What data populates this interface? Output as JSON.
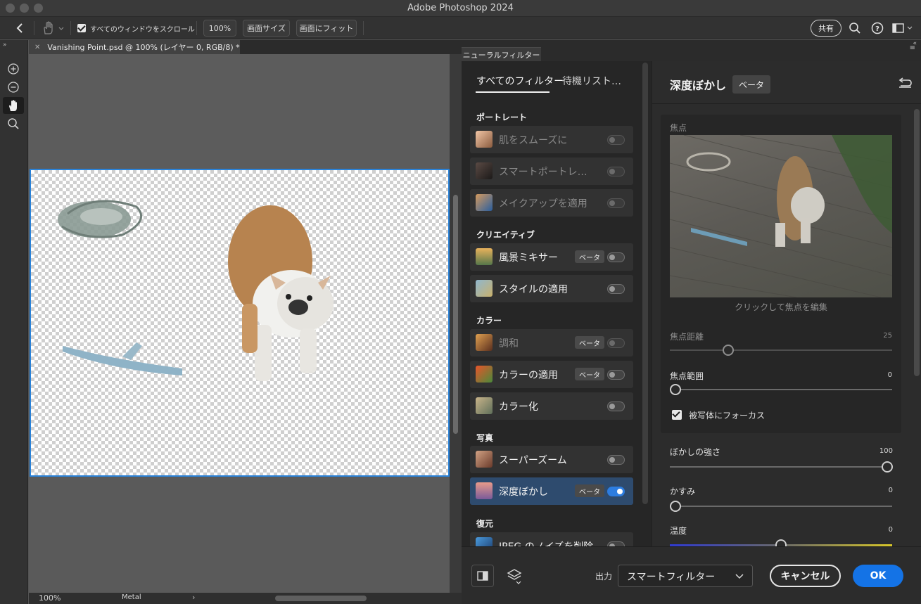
{
  "window": {
    "title": "Adobe Photoshop 2024"
  },
  "options_bar": {
    "scroll_all_label": "すべてのウィンドウをスクロール",
    "zoom_100": "100%",
    "fit_screen": "画面サイズ",
    "fill_screen": "画面にフィット",
    "share": "共有"
  },
  "document": {
    "tab_title": "Vanishing Point.psd @ 100% (レイヤー 0, RGB/8) *",
    "zoom": "100%",
    "status": "Metal"
  },
  "neural_filters": {
    "panel_tab": "ニューラルフィルター",
    "tabs": [
      {
        "label": "すべてのフィルター"
      },
      {
        "label": "待機リスト…"
      }
    ],
    "categories": [
      {
        "label": "ポートレート"
      },
      {
        "label": "クリエイティブ"
      },
      {
        "label": "カラー"
      },
      {
        "label": "写真"
      },
      {
        "label": "復元"
      }
    ],
    "items": [
      {
        "label": "肌をスムーズに",
        "beta": "",
        "on": false,
        "dim": true
      },
      {
        "label": "スマートポートレ…",
        "beta": "",
        "on": false,
        "dim": true
      },
      {
        "label": "メイクアップを適用",
        "beta": "",
        "on": false,
        "dim": true
      },
      {
        "label": "風景ミキサー",
        "beta": "ベータ",
        "on": false,
        "dim": false
      },
      {
        "label": "スタイルの適用",
        "beta": "",
        "on": false,
        "dim": false
      },
      {
        "label": "調和",
        "beta": "ベータ",
        "on": false,
        "dim": true
      },
      {
        "label": "カラーの適用",
        "beta": "ベータ",
        "on": false,
        "dim": false
      },
      {
        "label": "カラー化",
        "beta": "",
        "on": false,
        "dim": false
      },
      {
        "label": "スーパーズーム",
        "beta": "",
        "on": false,
        "dim": false
      },
      {
        "label": "深度ぼかし",
        "beta": "ベータ",
        "on": true,
        "dim": false
      },
      {
        "label": "JPEG のノイズを削除",
        "beta": "",
        "on": false,
        "dim": false
      }
    ],
    "detail": {
      "title": "深度ぼかし",
      "beta": "ベータ",
      "focal_point_label": "焦点",
      "click_hint": "クリックして焦点を編集",
      "focal_distance_label": "焦点距離",
      "focal_distance_value": "25",
      "focal_range_label": "焦点範囲",
      "focal_range_value": "0",
      "focus_subject_label": "被写体にフォーカス",
      "blur_strength_label": "ぼかしの強さ",
      "blur_strength_value": "100",
      "haze_label": "かすみ",
      "haze_value": "0",
      "temperature_label": "温度",
      "temperature_value": "0"
    },
    "footer": {
      "output_label": "出力",
      "output_value": "スマートフィルター",
      "cancel": "キャンセル",
      "ok": "OK"
    }
  }
}
